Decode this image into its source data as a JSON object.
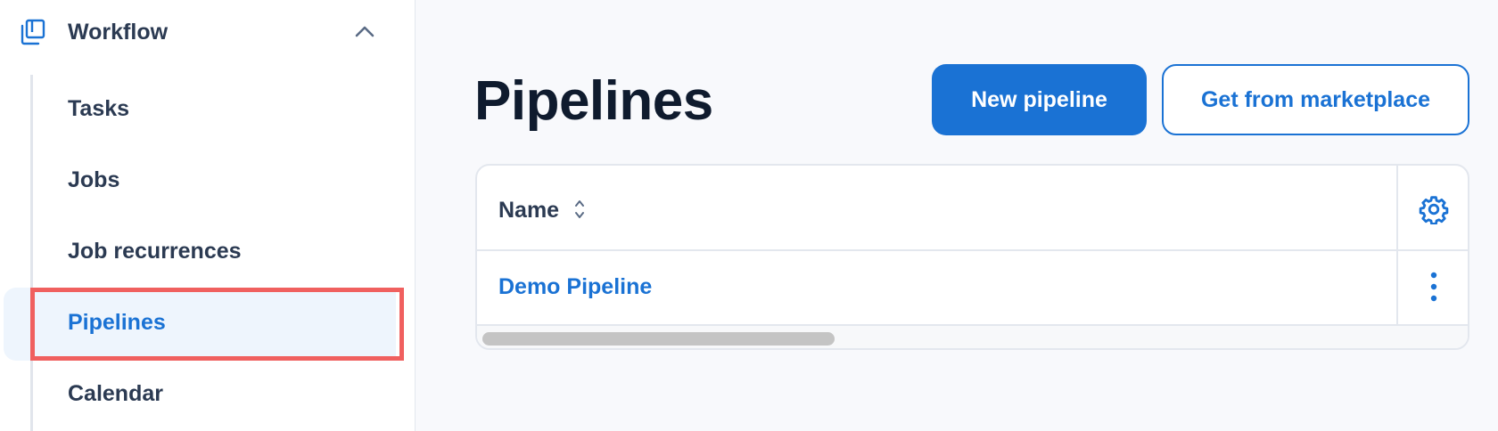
{
  "sidebar": {
    "section": {
      "title": "Workflow",
      "icon": "stacked-windows-icon",
      "collapse_icon": "chevron-up-icon"
    },
    "items": [
      {
        "label": "Tasks",
        "active": false
      },
      {
        "label": "Jobs",
        "active": false
      },
      {
        "label": "Job recurrences",
        "active": false
      },
      {
        "label": "Pipelines",
        "active": true
      },
      {
        "label": "Calendar",
        "active": false
      }
    ]
  },
  "main": {
    "title": "Pipelines",
    "buttons": {
      "new_pipeline": "New pipeline",
      "marketplace": "Get from marketplace"
    },
    "table": {
      "columns": [
        {
          "label": "Name",
          "sortable": true
        }
      ],
      "settings_icon": "gear-icon",
      "rows": [
        {
          "name": "Demo Pipeline",
          "actions_icon": "more-vertical-icon"
        }
      ]
    }
  },
  "colors": {
    "accent": "#1a72d4",
    "highlight": "#f0605f",
    "text": "#2b3a52"
  }
}
